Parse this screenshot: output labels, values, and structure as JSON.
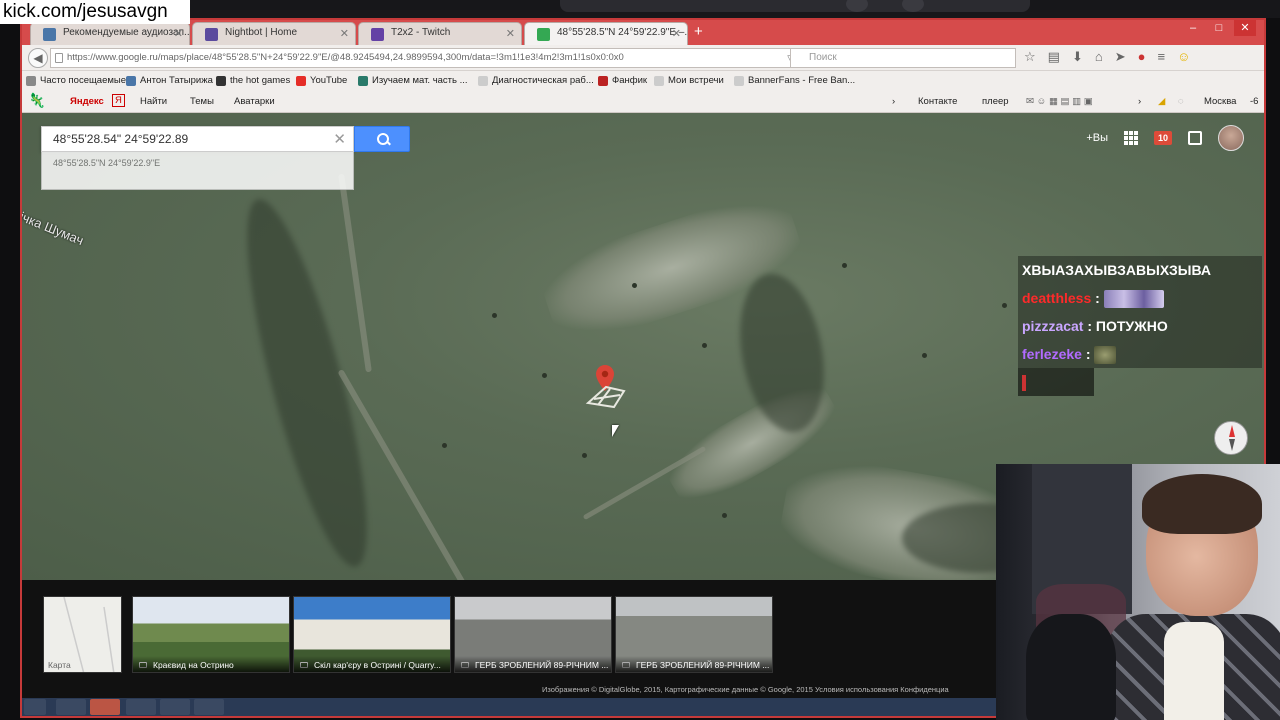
{
  "stream": {
    "watermark": "kick.com/jesusavgn"
  },
  "browser": {
    "tabs": [
      {
        "label": "Рекомендуемые аудиозап...",
        "favicon_color": "#4a76a8"
      },
      {
        "label": "Nightbot | Home",
        "favicon_color": "#5b4a9e"
      },
      {
        "label": "T2x2 - Twitch",
        "favicon_color": "#6441a5"
      },
      {
        "label": "48°55'28.5\"N 24°59'22.9\"E –...",
        "favicon_color": "#34a853"
      }
    ],
    "new_tab": "+",
    "url": "https://www.google.ru/maps/place/48°55'28.5\"N+24°59'22.9\"E/@48.9245494,24.9899594,300m/data=!3m1!1e3!4m2!3m1!1s0x0:0x0",
    "search_placeholder": "Поиск"
  },
  "bookmarks": [
    {
      "label": "Часто посещаемые",
      "color": "#888"
    },
    {
      "label": "Антон Татырижа",
      "color": "#4a76a8"
    },
    {
      "label": "the hot games",
      "color": "#333"
    },
    {
      "label": "YouTube",
      "color": "#e52d27"
    },
    {
      "label": "Изучаем мат. часть ...",
      "color": "#2a7a6a"
    },
    {
      "label": "Диагностическая раб...",
      "color": "#ccc"
    },
    {
      "label": "Фанфик",
      "color": "#b22"
    },
    {
      "label": "Мои встречи",
      "color": "#ccc"
    },
    {
      "label": "BannerFans - Free Ban...",
      "color": "#ccc"
    }
  ],
  "yandex_bar": {
    "brand": "Яндекс",
    "find": "Найти",
    "themes": "Темы",
    "avatars": "Аватарки",
    "contacts": "Контакте",
    "player": "плеер",
    "weather_city": "Москва",
    "weather_temp": "-6"
  },
  "map": {
    "search_value": "48°55'28.54\" 24°59'22.89",
    "suggestion": "48°55'28.5\"N 24°59'22.9\"E",
    "road_label": "ічка Шумач",
    "user_label": "+Вы",
    "notification_count": "10",
    "footer": "Изображения © DigitalGlobe, 2015, Картографические данные © Google, 2015    Условия использования    Конфиденциа",
    "photos": [
      {
        "caption": "Карта"
      },
      {
        "caption": "Краєвид на Острино"
      },
      {
        "caption": "Скіл кар'єру в Острині / Quarry..."
      },
      {
        "caption": "ГЕРБ ЗРОБЛЕНИЙ 89-РІЧНИМ ..."
      },
      {
        "caption": "ГЕРБ ЗРОБЛЕНИЙ 89-РІЧНИМ ..."
      }
    ]
  },
  "chat": {
    "messages": [
      {
        "user": "",
        "text": "ХВЫАЗАХЫВЗАВЫХЗЫВА",
        "user_color": "#ffffff"
      },
      {
        "user": "deatthless",
        "text": "",
        "user_color": "#ff2a2a"
      },
      {
        "user": "pizzzacat",
        "text": "ПОТУЖНО",
        "user_color": "#c9a6ff"
      },
      {
        "user": "ferlezeke",
        "text": "",
        "user_color": "#b26bff"
      }
    ]
  }
}
